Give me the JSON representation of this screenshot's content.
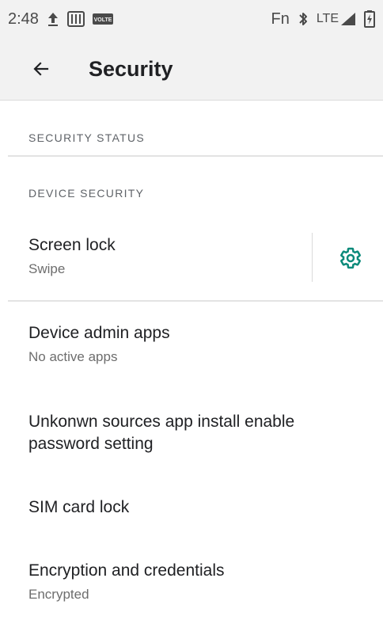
{
  "status_bar": {
    "time": "2:48",
    "volte": "VOLTE",
    "fn": "Fn",
    "network": "LTE"
  },
  "app_bar": {
    "title": "Security"
  },
  "sections": {
    "security_status": "SECURITY STATUS",
    "device_security": "DEVICE SECURITY"
  },
  "items": {
    "screen_lock": {
      "title": "Screen lock",
      "summary": "Swipe"
    },
    "device_admin": {
      "title": "Device admin apps",
      "summary": "No active apps"
    },
    "unknown_sources": {
      "title": "Unkonwn sources app install enable password setting"
    },
    "sim_lock": {
      "title": "SIM card lock"
    },
    "encryption": {
      "title": "Encryption and credentials",
      "summary": "Encrypted"
    }
  },
  "colors": {
    "accent": "#0b8a7a",
    "status_bar_bg": "#f2f2f2"
  },
  "icons": [
    "upload-icon",
    "sd-card-icon",
    "volte-icon",
    "bluetooth-icon",
    "signal-icon",
    "battery-charging-icon",
    "back-arrow-icon",
    "gear-icon"
  ]
}
